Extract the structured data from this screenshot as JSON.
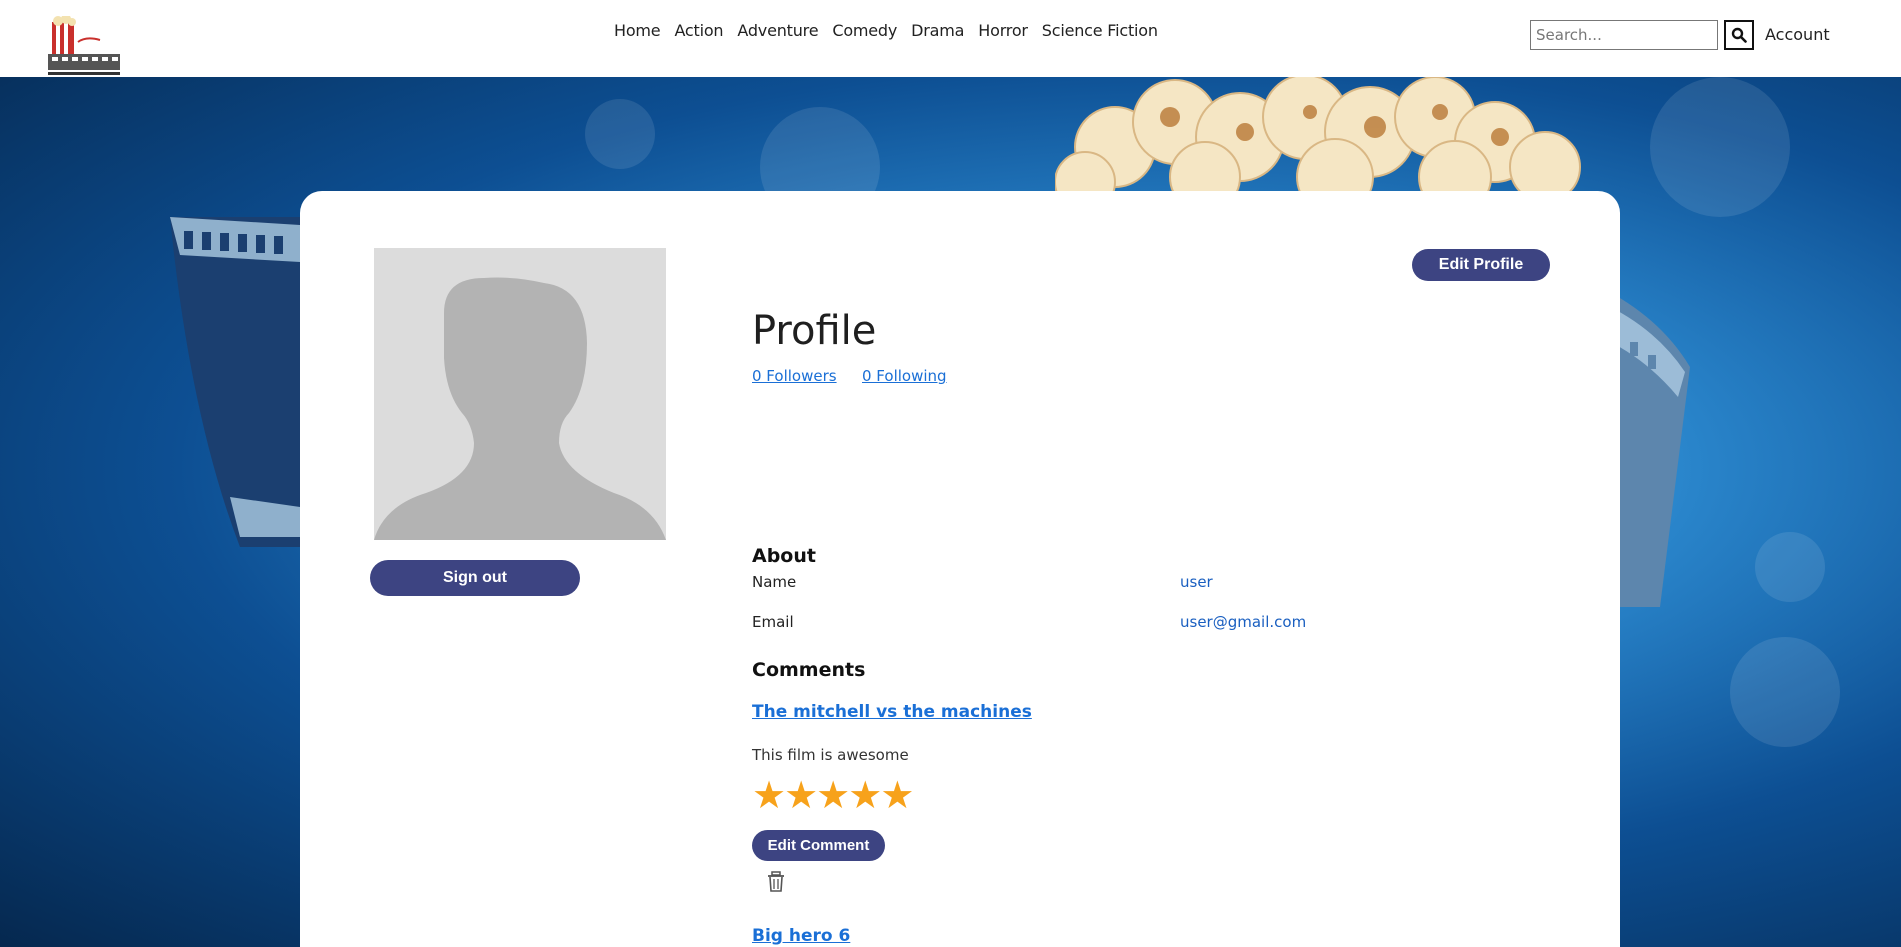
{
  "header": {
    "nav": [
      "Home",
      "Action",
      "Adventure",
      "Comedy",
      "Drama",
      "Horror",
      "Science Fiction"
    ],
    "search_placeholder": "Search...",
    "account_label": "Account"
  },
  "profile": {
    "title": "Profile",
    "followers_label": "0 Followers",
    "following_label": "0 Following",
    "edit_profile_label": "Edit Profile",
    "sign_out_label": "Sign out"
  },
  "about": {
    "heading": "About",
    "name_label": "Name",
    "name_value": "user",
    "email_label": "Email",
    "email_value": "user@gmail.com"
  },
  "comments": {
    "heading": "Comments",
    "items": [
      {
        "movie": "The mitchell vs the machines",
        "text": "This film is awesome",
        "rating": 5,
        "edit_label": "Edit Comment"
      },
      {
        "movie": "Big hero 6"
      }
    ]
  },
  "colors": {
    "accent": "#3d4482",
    "link": "#1a6fd6",
    "star": "#f7a21b"
  }
}
